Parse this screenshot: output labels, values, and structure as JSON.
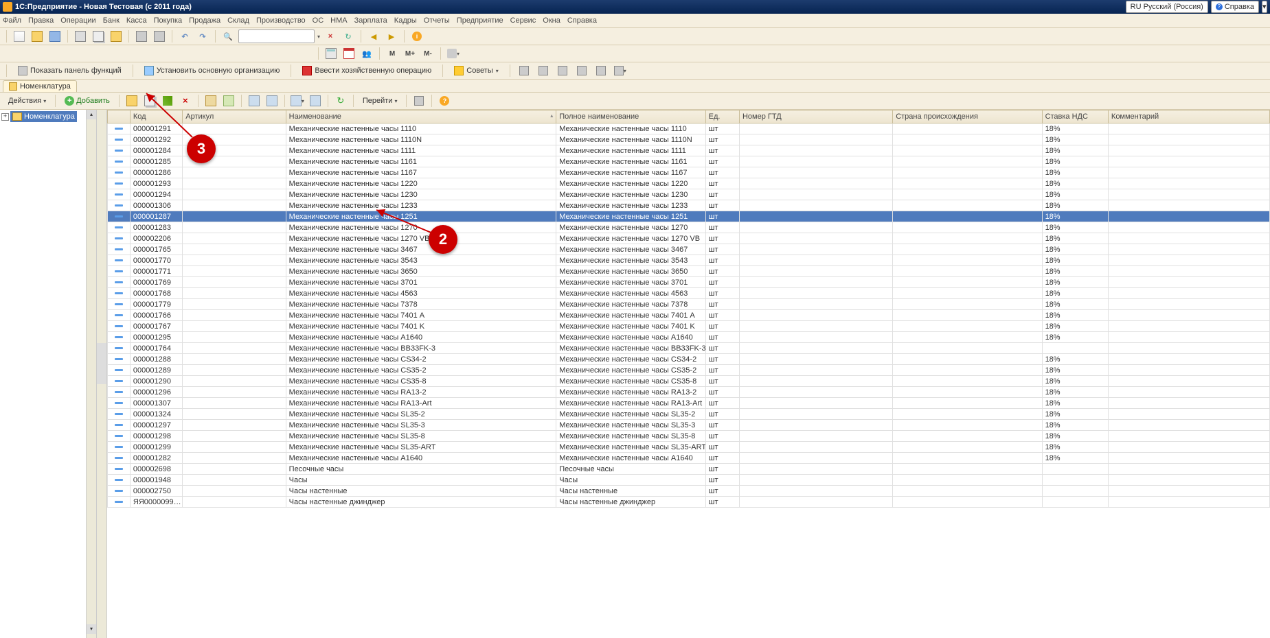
{
  "title": "1С:Предприятие - Новая Тестовая (с 2011 года)",
  "topright": {
    "lang": "RU Русский (Россия)",
    "help": "Справка"
  },
  "menu": [
    "Файл",
    "Правка",
    "Операции",
    "Банк",
    "Касса",
    "Покупка",
    "Продажа",
    "Склад",
    "Производство",
    "ОС",
    "НМА",
    "Зарплата",
    "Кадры",
    "Отчеты",
    "Предприятие",
    "Сервис",
    "Окна",
    "Справка"
  ],
  "mlabels": {
    "m": "M",
    "mplus": "M+",
    "mminus": "M-"
  },
  "fnbar": {
    "showpanel": "Показать панель функций",
    "setorg": "Установить основную организацию",
    "enterop": "Ввести хозяйственную операцию",
    "tips": "Советы"
  },
  "wintab": "Номенклатура",
  "actbar": {
    "actions": "Действия",
    "add": "Добавить",
    "goto": "Перейти"
  },
  "tree": {
    "root": "Номенклатура"
  },
  "columns": {
    "code": "Код",
    "art": "Артикул",
    "name": "Наименование",
    "full": "Полное наименование",
    "unit": "Ед.",
    "gtd": "Номер ГТД",
    "ctry": "Страна происхождения",
    "nds": "Ставка НДС",
    "comm": "Комментарий"
  },
  "annot": {
    "a2": "2",
    "a3": "3"
  },
  "rows": [
    {
      "code": "000001291",
      "name": "Механические настенные часы 1110",
      "full": "Механические настенные часы 1110",
      "unit": "шт",
      "nds": "18%"
    },
    {
      "code": "000001292",
      "name": "Механические настенные часы 1110N",
      "full": "Механические настенные часы 1110N",
      "unit": "шт",
      "nds": "18%"
    },
    {
      "code": "000001284",
      "name": "Механические настенные часы 1111",
      "full": "Механические настенные часы 1111",
      "unit": "шт",
      "nds": "18%"
    },
    {
      "code": "000001285",
      "name": "Механические настенные часы 1161",
      "full": "Механические настенные часы 1161",
      "unit": "шт",
      "nds": "18%"
    },
    {
      "code": "000001286",
      "name": "Механические настенные часы 1167",
      "full": "Механические настенные часы 1167",
      "unit": "шт",
      "nds": "18%"
    },
    {
      "code": "000001293",
      "name": "Механические настенные часы 1220",
      "full": "Механические настенные часы 1220",
      "unit": "шт",
      "nds": "18%"
    },
    {
      "code": "000001294",
      "name": "Механические настенные часы 1230",
      "full": "Механические настенные часы 1230",
      "unit": "шт",
      "nds": "18%"
    },
    {
      "code": "000001306",
      "name": "Механические настенные часы 1233",
      "full": "Механические настенные часы 1233",
      "unit": "шт",
      "nds": "18%"
    },
    {
      "code": "000001287",
      "name": "Механические настенные часы 1251",
      "full": "Механические настенные часы 1251",
      "unit": "шт",
      "nds": "18%",
      "sel": true
    },
    {
      "code": "000001283",
      "name": "Механические настенные часы 1270",
      "full": "Механические настенные часы 1270",
      "unit": "шт",
      "nds": "18%"
    },
    {
      "code": "000002206",
      "name": "Механические настенные часы 1270 VB",
      "full": "Механические настенные часы 1270 VB",
      "unit": "шт",
      "nds": "18%"
    },
    {
      "code": "000001765",
      "name": "Механические настенные часы 3467",
      "full": "Механические настенные часы 3467",
      "unit": "шт",
      "nds": "18%"
    },
    {
      "code": "000001770",
      "name": "Механические настенные часы 3543",
      "full": "Механические настенные часы 3543",
      "unit": "шт",
      "nds": "18%"
    },
    {
      "code": "000001771",
      "name": "Механические настенные часы 3650",
      "full": "Механические настенные часы 3650",
      "unit": "шт",
      "nds": "18%"
    },
    {
      "code": "000001769",
      "name": "Механические настенные часы 3701",
      "full": "Механические настенные часы 3701",
      "unit": "шт",
      "nds": "18%"
    },
    {
      "code": "000001768",
      "name": "Механические настенные часы 4563",
      "full": "Механические настенные часы 4563",
      "unit": "шт",
      "nds": "18%"
    },
    {
      "code": "000001779",
      "name": "Механические настенные часы 7378",
      "full": "Механические настенные часы 7378",
      "unit": "шт",
      "nds": "18%"
    },
    {
      "code": "000001766",
      "name": "Механические настенные часы 7401 A",
      "full": "Механические настенные часы 7401 A",
      "unit": "шт",
      "nds": "18%"
    },
    {
      "code": "000001767",
      "name": "Механические настенные часы 7401 K",
      "full": "Механические настенные часы 7401 K",
      "unit": "шт",
      "nds": "18%"
    },
    {
      "code": "000001295",
      "name": "Механические настенные часы A1640",
      "full": "Механические настенные часы A1640",
      "unit": "шт",
      "nds": "18%"
    },
    {
      "code": "000001764",
      "name": "Механические настенные часы BB33FK-3",
      "full": "Механические настенные часы BB33FK-3",
      "unit": "шт",
      "nds": ""
    },
    {
      "code": "000001288",
      "name": "Механические настенные часы CS34-2",
      "full": "Механические настенные часы CS34-2",
      "unit": "шт",
      "nds": "18%"
    },
    {
      "code": "000001289",
      "name": "Механические настенные часы CS35-2",
      "full": "Механические настенные часы CS35-2",
      "unit": "шт",
      "nds": "18%"
    },
    {
      "code": "000001290",
      "name": "Механические настенные часы CS35-8",
      "full": "Механические настенные часы CS35-8",
      "unit": "шт",
      "nds": "18%"
    },
    {
      "code": "000001296",
      "name": "Механические настенные часы RA13-2",
      "full": "Механические настенные часы RA13-2",
      "unit": "шт",
      "nds": "18%"
    },
    {
      "code": "000001307",
      "name": "Механические настенные часы RA13-Art",
      "full": "Механические настенные часы RA13-Art",
      "unit": "шт",
      "nds": "18%"
    },
    {
      "code": "000001324",
      "name": "Механические настенные часы SL35-2",
      "full": "Механические настенные часы SL35-2",
      "unit": "шт",
      "nds": "18%"
    },
    {
      "code": "000001297",
      "name": "Механические настенные часы SL35-3",
      "full": "Механические настенные часы SL35-3",
      "unit": "шт",
      "nds": "18%"
    },
    {
      "code": "000001298",
      "name": "Механические настенные часы SL35-8",
      "full": "Механические настенные часы SL35-8",
      "unit": "шт",
      "nds": "18%"
    },
    {
      "code": "000001299",
      "name": "Механические настенные часы SL35-ART",
      "full": "Механические настенные часы SL35-ART",
      "unit": "шт",
      "nds": "18%"
    },
    {
      "code": "000001282",
      "name": "Механические настенные часы А1640",
      "full": "Механические настенные часы А1640",
      "unit": "шт",
      "nds": "18%"
    },
    {
      "code": "000002698",
      "name": "Песочные часы",
      "full": "Песочные часы",
      "unit": "шт",
      "nds": ""
    },
    {
      "code": "000001948",
      "name": "Часы",
      "full": "Часы",
      "unit": "шт",
      "nds": ""
    },
    {
      "code": "000002750",
      "name": "Часы настенные",
      "full": "Часы настенные",
      "unit": "шт",
      "nds": ""
    },
    {
      "code": "ЯЯ0000099…",
      "name": "Часы настенные джинджер",
      "full": "Часы настенные джинджер",
      "unit": "шт",
      "nds": ""
    }
  ]
}
